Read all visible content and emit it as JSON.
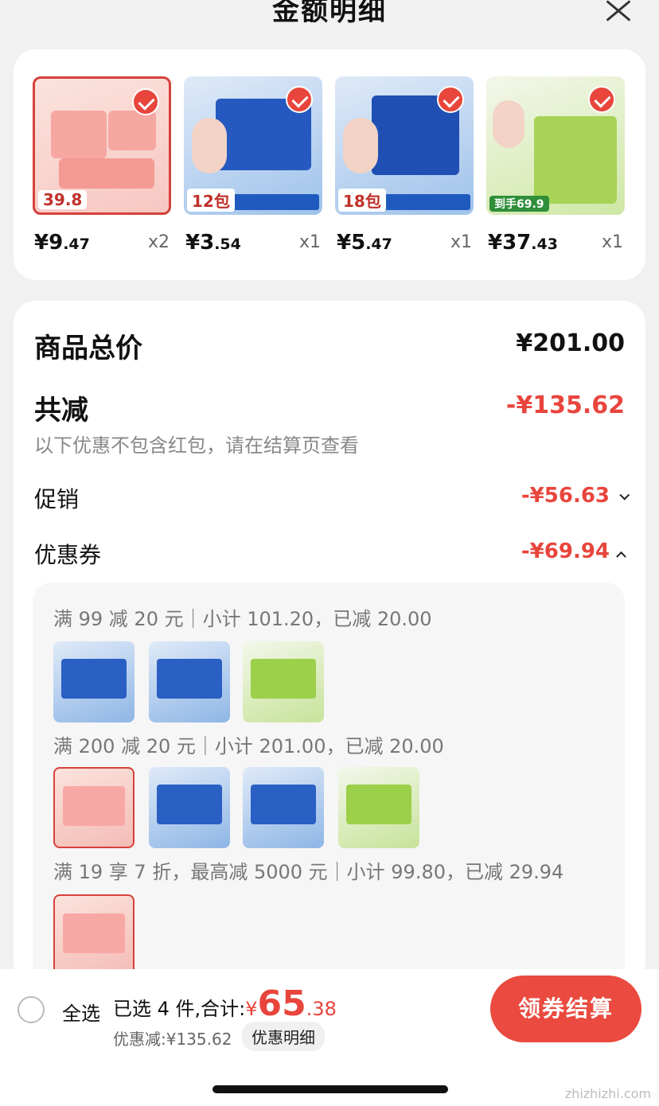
{
  "header": {
    "title": "金额明细"
  },
  "products": [
    {
      "price_int": "¥9",
      "price_dec": ".47",
      "qty": "x2",
      "tag": "39.8",
      "theme": "pink"
    },
    {
      "price_int": "¥3",
      "price_dec": ".54",
      "qty": "x1",
      "tag": "12包",
      "theme": "blue"
    },
    {
      "price_int": "¥5",
      "price_dec": ".47",
      "qty": "x1",
      "tag": "18包",
      "theme": "blue"
    },
    {
      "price_int": "¥37",
      "price_dec": ".43",
      "qty": "x1",
      "tag": "到手69.9",
      "theme": "green"
    }
  ],
  "details": {
    "total_label": "商品总价",
    "total_value": "¥201.00",
    "reduce_label": "共减",
    "reduce_value": "-¥135.62",
    "note": "以下优惠不包含红包，请在结算页查看",
    "promo_label": "促销",
    "promo_value": "-¥56.63",
    "coupon_label": "优惠券",
    "coupon_value": "-¥69.94"
  },
  "coupons": [
    {
      "text": "满 99 减 20 元｜小计 101.20，已减 20.00",
      "items": [
        "blue",
        "blue",
        "green"
      ]
    },
    {
      "text": "满 200 减 20 元｜小计 201.00，已减 20.00",
      "items": [
        "pink",
        "blue",
        "blue",
        "green"
      ]
    },
    {
      "text": "满 19 享 7 折，最高减 5000 元｜小计 99.80，已减 29.94",
      "items": [
        "pink"
      ]
    }
  ],
  "bottom": {
    "select_all": "全选",
    "selected_text": "已选 4 件,合计:",
    "total_yen": "¥",
    "total_int": "65",
    "total_dec": ".38",
    "discount_text": "优惠减:¥135.62",
    "detail_label": "优惠明细",
    "checkout_label": "领券结算"
  },
  "watermark": "zhizhizhi.com"
}
